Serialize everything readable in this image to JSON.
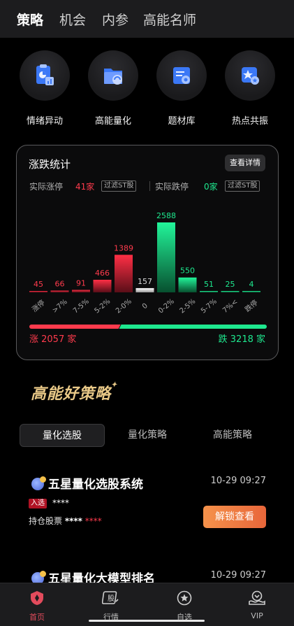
{
  "top_tabs": [
    "策略",
    "机会",
    "内参",
    "高能名师"
  ],
  "features": [
    {
      "label": "情绪异动",
      "icon": "chart-clipboard-icon"
    },
    {
      "label": "高能量化",
      "icon": "folder-gauge-icon"
    },
    {
      "label": "题材库",
      "icon": "list-document-icon"
    },
    {
      "label": "热点共振",
      "icon": "star-folder-icon"
    }
  ],
  "stats": {
    "title": "涨跌统计",
    "detail_button": "查看详情",
    "limit_up_label": "实际涨停",
    "limit_up_value": "41家",
    "limit_down_label": "实际跌停",
    "limit_down_value": "0家",
    "filter_label": "过滤ST股",
    "up_total": "涨 2057 家",
    "down_total": "跌 3218 家",
    "colors": {
      "up": "#ff3b4d",
      "down": "#1ee88f",
      "flat": "#d8d8d8"
    }
  },
  "chart_data": {
    "type": "bar",
    "categories": [
      "涨停",
      ">7%",
      "7-5%",
      "5-2%",
      "2-0%",
      "0",
      "0-2%",
      "2-5%",
      "5-7%",
      "7%<",
      "跌停"
    ],
    "values": [
      45,
      66,
      91,
      466,
      1389,
      157,
      2588,
      550,
      51,
      25,
      4
    ],
    "directions": [
      "up",
      "up",
      "up",
      "up",
      "up",
      "flat",
      "down",
      "down",
      "down",
      "down",
      "down"
    ],
    "up_ratio": 0.39
  },
  "strategy": {
    "logo_text": "高能好策略",
    "segments": [
      "量化选股",
      "量化策略",
      "高能策略"
    ],
    "cards": [
      {
        "title": "五星量化选股系统",
        "time": "10-29 09:27",
        "tag": "入选",
        "tag_value": "****",
        "hold_label": "持仓股票",
        "hold_value1": "****",
        "hold_value2": "****",
        "action": "解锁查看"
      },
      {
        "title": "五星量化大模型排名",
        "time": "10-29 09:27"
      }
    ]
  },
  "bottom_nav": [
    {
      "label": "首页",
      "icon": "home-shield-icon"
    },
    {
      "label": "行情",
      "icon": "market-icon"
    },
    {
      "label": "自选",
      "icon": "star-circle-icon"
    },
    {
      "label": "VIP",
      "icon": "vip-icon"
    }
  ]
}
